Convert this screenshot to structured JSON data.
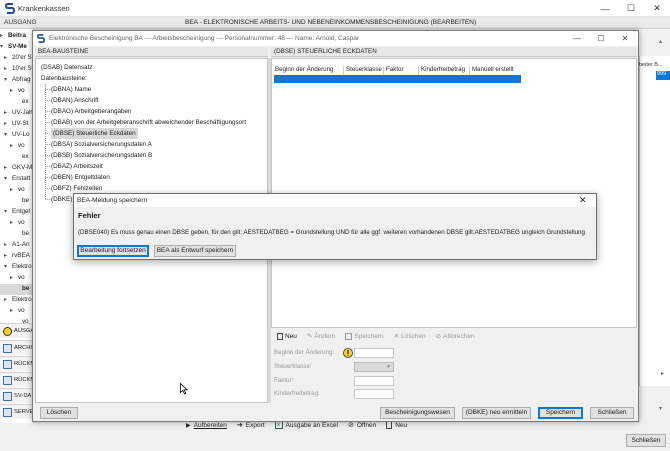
{
  "outer": {
    "title": "Krankenkassen",
    "header_left": "AUSGANG",
    "header_center": "BEA - ELEKTRONISCHE ARBEITS- UND NEBENEINKOMMENSBESCHEINIGUNG (BEARBEITEN)",
    "tree": [
      {
        "label": "Beitra",
        "arrow": "▸",
        "indent": 4,
        "bold": true
      },
      {
        "label": "SV-Me",
        "arrow": "▾",
        "indent": 4,
        "bold": true
      },
      {
        "label": "20'er S",
        "arrow": "▸",
        "indent": 8,
        "bold": false
      },
      {
        "label": "10'er S",
        "arrow": "▸",
        "indent": 8,
        "bold": false
      },
      {
        "label": "Abfrag",
        "arrow": "▾",
        "indent": 8,
        "bold": false
      },
      {
        "label": "vo",
        "arrow": "▸",
        "indent": 14,
        "bold": false
      },
      {
        "label": "ex",
        "arrow": "",
        "indent": 18,
        "bold": false
      },
      {
        "label": "UV-Jah",
        "arrow": "▸",
        "indent": 8,
        "bold": false
      },
      {
        "label": "UV-St",
        "arrow": "▸",
        "indent": 8,
        "bold": false
      },
      {
        "label": "UV-Lo",
        "arrow": "▾",
        "indent": 8,
        "bold": false
      },
      {
        "label": "vo",
        "arrow": "▸",
        "indent": 14,
        "bold": false
      },
      {
        "label": "ex",
        "arrow": "",
        "indent": 18,
        "bold": false
      },
      {
        "label": "GKV-M",
        "arrow": "▸",
        "indent": 8,
        "bold": false
      },
      {
        "label": "Erstatt",
        "arrow": "▾",
        "indent": 8,
        "bold": false
      },
      {
        "label": "vo",
        "arrow": "▸",
        "indent": 14,
        "bold": false
      },
      {
        "label": "be",
        "arrow": "",
        "indent": 18,
        "bold": false
      },
      {
        "label": "Entgel",
        "arrow": "▾",
        "indent": 8,
        "bold": false
      },
      {
        "label": "vo",
        "arrow": "▸",
        "indent": 14,
        "bold": false
      },
      {
        "label": "be",
        "arrow": "",
        "indent": 18,
        "bold": false
      },
      {
        "label": "A1-An",
        "arrow": "▸",
        "indent": 8,
        "bold": false
      },
      {
        "label": "rvBEA",
        "arrow": "▸",
        "indent": 8,
        "bold": false
      },
      {
        "label": "Elektro",
        "arrow": "▾",
        "indent": 8,
        "bold": false
      },
      {
        "label": "vo",
        "arrow": "▸",
        "indent": 14,
        "bold": false
      },
      {
        "label": "be",
        "arrow": "",
        "indent": 18,
        "bold": true,
        "selected": true
      },
      {
        "label": "Elektro",
        "arrow": "▸",
        "indent": 8,
        "bold": false
      },
      {
        "label": "vo",
        "arrow": "▸",
        "indent": 14,
        "bold": false
      },
      {
        "label": "vo",
        "arrow": "",
        "indent": 18,
        "bold": false
      }
    ],
    "side_buttons": [
      {
        "label": "AUSGA",
        "icon": "warning-icon"
      },
      {
        "label": "ARCHI",
        "icon": "archive-icon"
      },
      {
        "label": "RÜCKM",
        "icon": "return-icon"
      },
      {
        "label": "RÜCKM",
        "icon": "return-icon"
      },
      {
        "label": "SV-DA",
        "icon": "database-icon"
      },
      {
        "label": "SERVE",
        "icon": "server-icon"
      }
    ],
    "right_strip_header": "beiter B...",
    "right_strip_value": "999",
    "toolbar": {
      "bearbeiten": "Aufbereiten",
      "export": "Export",
      "ausgabe": "Ausgabe an Excel",
      "oeffnen": "Öffnen",
      "neu": "Neu"
    },
    "close_label": "Schließen"
  },
  "dialog": {
    "title": "Elektronische Bescheinigung BA  ---  Arbeitsbescheinigung  ---  Personalnummer: 48  ---  Name: Arnold, Caspar",
    "left_header": "BEA-BAUSTEINE",
    "right_header": "(DBSE) STEUERLICHE ECKDATEN",
    "tree": [
      {
        "label": "(DSAB) Datensatz",
        "indent": 5
      },
      {
        "label": "Datenbausteine:",
        "indent": 5
      },
      {
        "label": "(DBNA) Name",
        "indent": 15
      },
      {
        "label": "(DBAN) Anschrift",
        "indent": 15
      },
      {
        "label": "(DBAG) Arbeitgeberangaben",
        "indent": 15
      },
      {
        "label": "(DBAB) von der Arbeitgeberanschrift abweichender Beschäftigungsort",
        "indent": 15
      },
      {
        "label": "(DBSE) Steuerliche Eckdaten",
        "indent": 15,
        "selected": true
      },
      {
        "label": "(DBSA) Sozialversicherungsdaten A",
        "indent": 15
      },
      {
        "label": "(DBSB) Sozialversicherungsdaten B",
        "indent": 15
      },
      {
        "label": "(DBAZ) Arbeitszeit",
        "indent": 15
      },
      {
        "label": "(DBEN) Entgeltdaten",
        "indent": 15
      },
      {
        "label": "(DBFZ) Fehlzeiten",
        "indent": 15
      },
      {
        "label": "(DBKE) K",
        "indent": 15
      }
    ],
    "grid_columns": [
      "Beginn der Änderung",
      "Steuerklasse",
      "Faktor",
      "Kinderfreibetrag",
      "Manuell erstellt"
    ],
    "editor_toolbar": {
      "neu": "Neu",
      "aendern": "Ändern",
      "speichern": "Speichern",
      "loeschen": "Löschen",
      "abbrechen": "Abbrechen"
    },
    "fields": {
      "beginn": "Beginn der Änderung:",
      "steuerklasse": "Steuerklasse:",
      "faktor": "Faktor:",
      "kinderfreibetrag": "Kinderfreibetrag:"
    },
    "buttons": {
      "loeschen": "Löschen",
      "bescheinigungswesen": "Bescheinigungswesen",
      "neu_ermitteln": "(DBKE) neu ermitteln",
      "speichern": "Speichern",
      "schliessen": "Schließen"
    }
  },
  "message_box": {
    "title": "BEA-Meldung speichern",
    "heading": "Fehler",
    "text": "(DBSE040) Es muss genau einen DBSE geben, für den gilt: AESTEDATBEG = Grundstellung UND für alle ggf. weiteren vorhandenen DBSE gilt:AESTEDATBEG ungleich Grundstellung",
    "btn_continue": "Bearbeitung fortsetzen",
    "btn_draft": "BEA als Entwurf speichern"
  },
  "colors": {
    "accent": "#0a78d7",
    "selection_gray": "#d9d9d9",
    "window_bg": "#f0f0f0"
  }
}
